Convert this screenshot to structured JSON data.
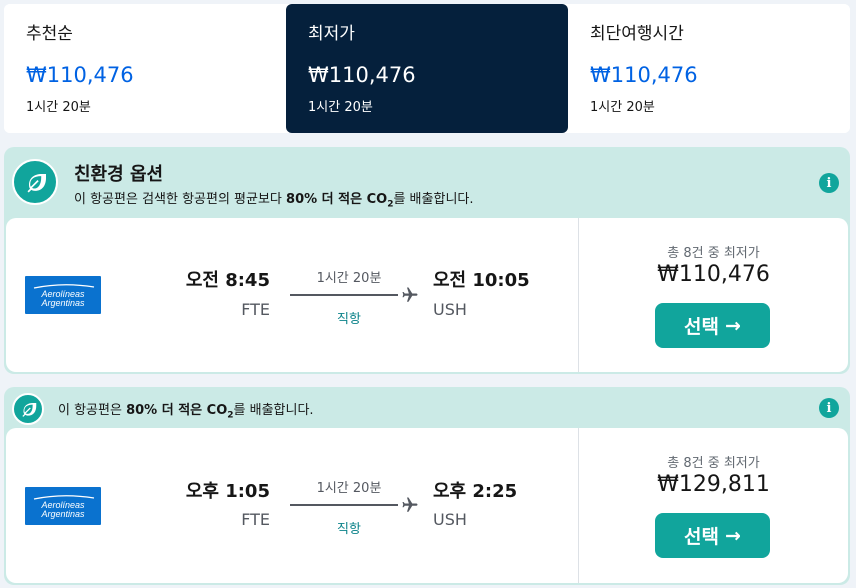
{
  "sort_tabs": [
    {
      "label": "추천순",
      "price": "₩110,476",
      "duration": "1시간 20분",
      "active": false
    },
    {
      "label": "최저가",
      "price": "₩110,476",
      "duration": "1시간 20분",
      "active": true
    },
    {
      "label": "최단여행시간",
      "price": "₩110,476",
      "duration": "1시간 20분",
      "active": false
    }
  ],
  "colors": {
    "active_tab": "#05203c",
    "price_link": "#0062e3",
    "eco_bg": "#cbeae6",
    "eco_accent": "#11a59c",
    "airline_logo": "#0a72cf"
  },
  "eco_option": {
    "title": "친환경 옵션",
    "desc_prefix": "이 항공편은 검색한 항공편의 평균보다 ",
    "desc_bold": "80% 더 적은 CO",
    "desc_sub": "2",
    "desc_suffix": "를 배출합니다.",
    "info_icon": "i"
  },
  "eco_short": {
    "desc_prefix": "이 항공편은 ",
    "desc_bold": "80% 더 적은 CO",
    "desc_sub": "2",
    "desc_suffix": "를 배출합니다.",
    "info_icon": "i"
  },
  "flights": [
    {
      "airline_logo_text_1": "Aerolíneas",
      "airline_logo_text_2": "Argentinas",
      "dep_time": "오전 8:45",
      "dep_code": "FTE",
      "duration": "1시간 20분",
      "stops": "직항",
      "arr_time": "오전 10:05",
      "arr_code": "USH",
      "deals_label": "총 8건 중 최저가",
      "price": "₩110,476",
      "select_label": "선택",
      "select_arrow": "→"
    },
    {
      "airline_logo_text_1": "Aerolíneas",
      "airline_logo_text_2": "Argentinas",
      "dep_time": "오후 1:05",
      "dep_code": "FTE",
      "duration": "1시간 20분",
      "stops": "직항",
      "arr_time": "오후 2:25",
      "arr_code": "USH",
      "deals_label": "총 8건 중 최저가",
      "price": "₩129,811",
      "select_label": "선택",
      "select_arrow": "→"
    }
  ]
}
